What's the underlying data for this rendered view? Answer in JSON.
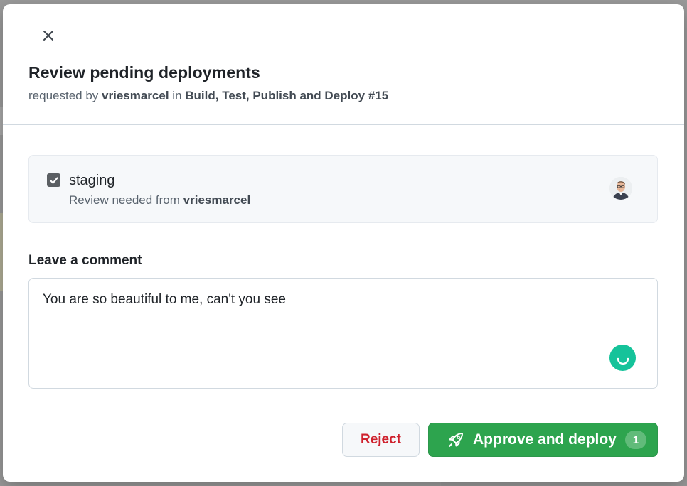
{
  "dialog": {
    "close_icon": "close-icon",
    "title": "Review pending deployments",
    "subtitle": {
      "prefix": "requested by",
      "user": "vriesmarcel",
      "joiner": "in",
      "workflow": "Build, Test, Publish and Deploy #15"
    }
  },
  "environment": {
    "checked": true,
    "name": "staging",
    "review_prefix": "Review needed from",
    "reviewer": "vriesmarcel",
    "avatar_icon": "reviewer-avatar"
  },
  "comment": {
    "label": "Leave a comment",
    "value": "You are so beautiful to me, can't you see",
    "assistant_icon": "grammarly-icon"
  },
  "actions": {
    "reject_label": "Reject",
    "approve_label": "Approve and deploy",
    "approve_count": "1",
    "approve_icon": "rocket-icon"
  },
  "colors": {
    "approve": "#2da44e",
    "reject_text": "#cf222e",
    "assistant": "#15c39a"
  }
}
